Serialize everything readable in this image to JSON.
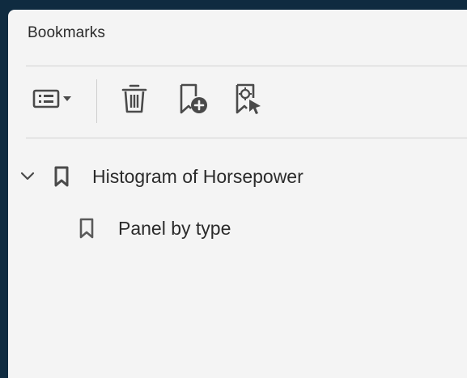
{
  "panel": {
    "title": "Bookmarks"
  },
  "toolbar": {
    "buttons": [
      {
        "name": "options-menu",
        "icon": "list-options-icon"
      },
      {
        "name": "delete-bookmark",
        "icon": "trash-icon"
      },
      {
        "name": "new-bookmark",
        "icon": "add-bookmark-icon"
      },
      {
        "name": "new-bookmark-from-structure",
        "icon": "bookmark-select-icon"
      }
    ]
  },
  "bookmarks": [
    {
      "label": "Histogram of Horsepower",
      "expanded": true,
      "level": 0
    },
    {
      "label": "Panel by type",
      "level": 1
    }
  ],
  "colors": {
    "background": "#0f2b40",
    "panel": "#f4f4f4",
    "text": "#2b2b2b",
    "icon": "#4a4a4a"
  }
}
